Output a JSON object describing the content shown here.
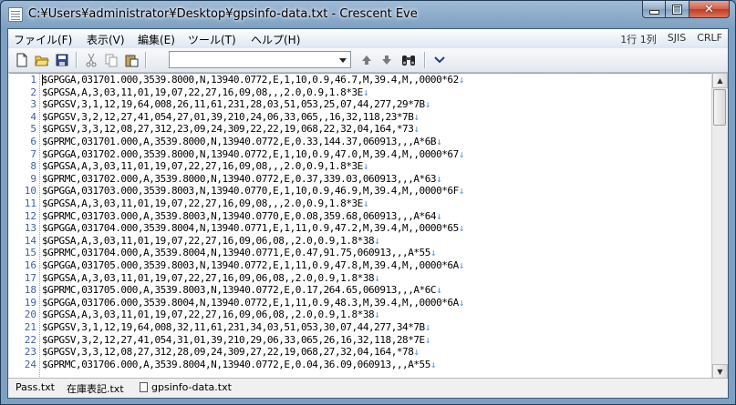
{
  "window": {
    "title": "C:¥Users¥administrator¥Desktop¥gpsinfo-data.txt - Crescent Eve"
  },
  "menu": [
    "ファイル(F)",
    "表示(V)",
    "編集(E)",
    "ツール(T)",
    "ヘルプ(H)"
  ],
  "status": {
    "position": "1行 1列",
    "encoding": "SJIS",
    "newline": "CRLF"
  },
  "toolbar": {
    "new": "new-file-icon",
    "open": "open-folder-icon",
    "save": "save-disk-icon",
    "cut": "scissors-icon",
    "copy": "copy-icon",
    "paste": "paste-icon",
    "search_value": "",
    "prev": "arrow-up-icon",
    "next": "arrow-down-icon",
    "find": "binoculars-icon",
    "dropdown": "chevron-down-icon"
  },
  "lines": [
    "$GPGGA,031701.000,3539.8000,N,13940.0772,E,1,10,0.9,46.7,M,39.4,M,,0000*62",
    "$GPGSA,A,3,03,11,01,19,07,22,27,16,09,08,,,2.0,0.9,1.8*3E",
    "$GPGSV,3,1,12,19,64,008,26,11,61,231,28,03,51,053,25,07,44,277,29*7B",
    "$GPGSV,3,2,12,27,41,054,27,01,39,210,24,06,33,065,,16,32,118,23*7B",
    "$GPGSV,3,3,12,08,27,312,23,09,24,309,22,22,19,068,22,32,04,164,*73",
    "$GPRMC,031701.000,A,3539.8000,N,13940.0772,E,0.33,144.37,060913,,,A*6B",
    "$GPGGA,031702.000,3539.8000,N,13940.0772,E,1,10,0.9,47.0,M,39.4,M,,0000*67",
    "$GPGSA,A,3,03,11,01,19,07,22,27,16,09,08,,,2.0,0.9,1.8*3E",
    "$GPRMC,031702.000,A,3539.8000,N,13940.0772,E,0.37,339.03,060913,,,A*63",
    "$GPGGA,031703.000,3539.8003,N,13940.0770,E,1,10,0.9,46.9,M,39.4,M,,0000*6F",
    "$GPGSA,A,3,03,11,01,19,07,22,27,16,09,08,,,2.0,0.9,1.8*3E",
    "$GPRMC,031703.000,A,3539.8003,N,13940.0770,E,0.08,359.68,060913,,,A*64",
    "$GPGGA,031704.000,3539.8004,N,13940.0771,E,1,11,0.9,47.2,M,39.4,M,,0000*65",
    "$GPGSA,A,3,03,11,01,19,07,22,27,16,09,06,08,,2.0,0.9,1.8*38",
    "$GPRMC,031704.000,A,3539.8004,N,13940.0771,E,0.47,91.75,060913,,,A*55",
    "$GPGGA,031705.000,3539.8003,N,13940.0772,E,1,11,0.9,47.8,M,39.4,M,,0000*6A",
    "$GPGSA,A,3,03,11,01,19,07,22,27,16,09,06,08,,2.0,0.9,1.8*38",
    "$GPRMC,031705.000,A,3539.8003,N,13940.0772,E,0.17,264.65,060913,,,A*6C",
    "$GPGGA,031706.000,3539.8004,N,13940.0772,E,1,11,0.9,48.3,M,39.4,M,,0000*6A",
    "$GPGSA,A,3,03,11,01,19,07,22,27,16,09,06,08,,2.0,0.9,1.8*38",
    "$GPGSV,3,1,12,19,64,008,32,11,61,231,34,03,51,053,30,07,44,277,34*7B",
    "$GPGSV,3,2,12,27,41,054,31,01,39,210,29,06,33,065,26,16,32,118,28*7E",
    "$GPGSV,3,3,12,08,27,312,28,09,24,309,27,22,19,068,27,32,04,164,*78",
    "$GPRMC,031706.000,A,3539.8004,N,13940.0772,E,0.04,36.09,060913,,,A*55"
  ],
  "eol_mark": "↓",
  "tabs": [
    "Pass.txt",
    "在庫表記.txt",
    "gpsinfo-data.txt"
  ]
}
